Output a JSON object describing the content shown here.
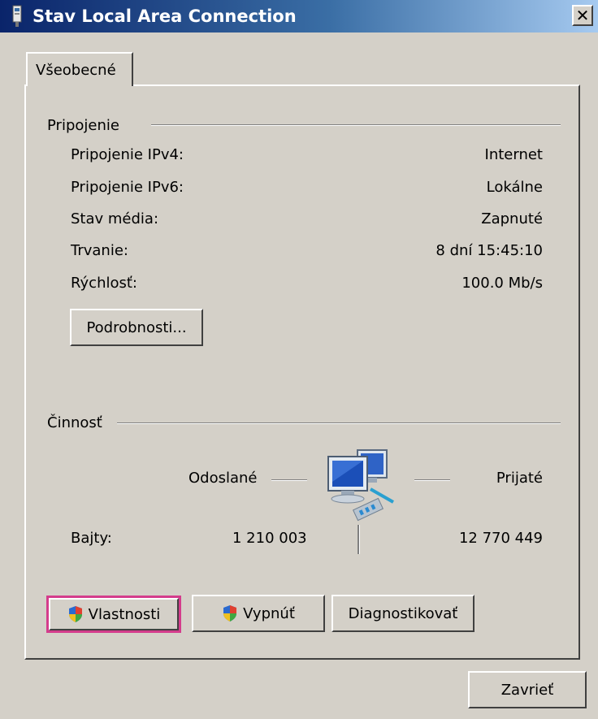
{
  "window": {
    "title": "Stav Local Area Connection",
    "close_symbol": "✕"
  },
  "tabs": [
    {
      "label": "Všeobecné",
      "selected": true
    }
  ],
  "connection": {
    "group_title": "Pripojenie",
    "rows": [
      {
        "label": "Pripojenie IPv4:",
        "value": "Internet"
      },
      {
        "label": "Pripojenie IPv6:",
        "value": "Lokálne"
      },
      {
        "label": "Stav média:",
        "value": "Zapnuté"
      },
      {
        "label": "Trvanie:",
        "value": "8 dní 15:45:10"
      },
      {
        "label": "Rýchlosť:",
        "value": "100.0 Mb/s"
      }
    ],
    "details_button": "Podrobnosti..."
  },
  "activity": {
    "group_title": "Činnosť",
    "sent_label": "Odoslané",
    "received_label": "Prijaté",
    "bytes_label": "Bajty:",
    "bytes_sent": "1 210 003",
    "bytes_received": "12 770 449",
    "icon": "network-computers-icon"
  },
  "buttons": {
    "properties": "Vlastnosti",
    "disable": "Vypnúť",
    "diagnose": "Diagnostikovať",
    "close": "Zavrieť"
  },
  "colors": {
    "titlebar_start": "#0a246a",
    "titlebar_end": "#a6caf0",
    "face": "#d4d0c8",
    "focus_outline": "#d43c8c"
  }
}
